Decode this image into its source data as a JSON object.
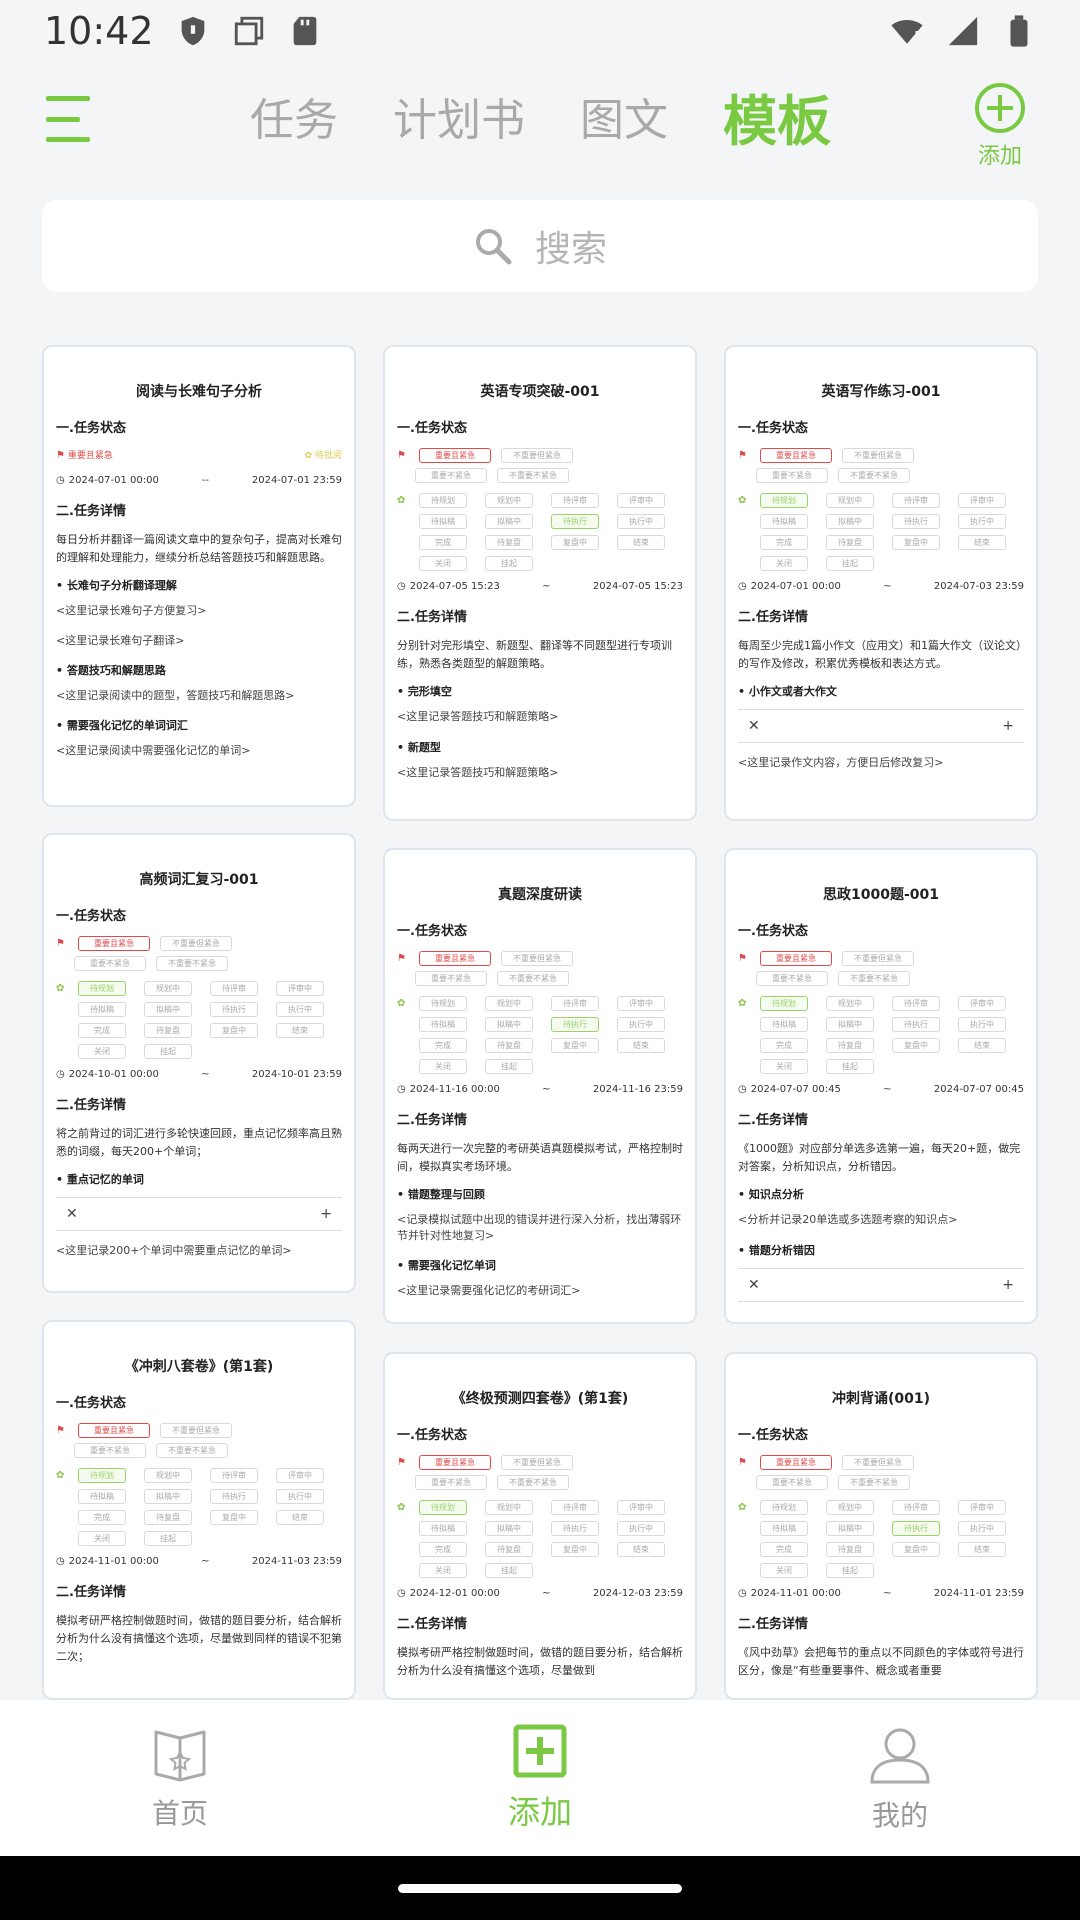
{
  "status_bar": {
    "time": "10:42"
  },
  "header": {
    "tabs": [
      "任务",
      "计划书",
      "图文",
      "模板"
    ],
    "active_tab": "模板",
    "add_label": "添加"
  },
  "search": {
    "placeholder": "搜索"
  },
  "cards": [
    {
      "title": "阅读与长难句子分析",
      "section1": "一.任务状态",
      "status_a": "重要且紧急",
      "status_b": "待批阅",
      "date_start": "2024-07-01 00:00",
      "date_sep": "--",
      "date_end": "2024-07-01 23:59",
      "section2": "二.任务详情",
      "desc": "每日分析并翻译一篇阅读文章中的复杂句子，提高对长难句的理解和处理能力，继续分析总结答题技巧和解题思路。",
      "b1": "长难句子分析翻译理解",
      "n1": "<这里记录长难句子方便复习>",
      "n2": "<这里记录长难句子翻译>",
      "b2": "答题技巧和解题思路",
      "n3": "<这里记录阅读中的题型，答题技巧和解题思路>",
      "b3": "需要强化记忆的单词词汇",
      "n4": "<这里记录阅读中需要强化记忆的单词>"
    },
    {
      "title": "英语专项突破-001",
      "section1": "一.任务状态",
      "date_start": "2024-07-05 15:23",
      "date_sep": "~",
      "date_end": "2024-07-05 15:23",
      "section2": "二.任务详情",
      "desc": "分别针对完形填空、新题型、翻译等不同题型进行专项训练，熟悉各类题型的解题策略。",
      "b1": "完形填空",
      "n1": "<这里记录答题技巧和解题策略>",
      "b2": "新题型",
      "n2": "<这里记录答题技巧和解题策略>"
    },
    {
      "title": "英语写作练习-001",
      "section1": "一.任务状态",
      "date_start": "2024-07-01 00:00",
      "date_sep": "~",
      "date_end": "2024-07-03 23:59",
      "section2": "二.任务详情",
      "desc": "每周至少完成1篇小作文（应用文）和1篇大作文（议论文）的写作及修改，积累优秀模板和表达方式。",
      "b1": "小作文或者大作文",
      "n1": "<这里记录作文内容，方便日后修改复习>"
    },
    {
      "title": "高频词汇复习-001",
      "section1": "一.任务状态",
      "date_start": "2024-10-01 00:00",
      "date_sep": "~",
      "date_end": "2024-10-01 23:59",
      "section2": "二.任务详情",
      "desc": "将之前背过的词汇进行多轮快速回顾，重点记忆频率高且熟悉的词缀，每天200+个单词；",
      "b1": "重点记忆的单词",
      "n1": "<这里记录200+个单词中需要重点记忆的单词>"
    },
    {
      "title": "真题深度研读",
      "section1": "一.任务状态",
      "date_start": "2024-11-16 00:00",
      "date_sep": "~",
      "date_end": "2024-11-16 23:59",
      "section2": "二.任务详情",
      "desc": "每两天进行一次完整的考研英语真题模拟考试，严格控制时间，模拟真实考场环境。",
      "b1": "错题整理与回顾",
      "n1": "<记录模拟试题中出现的错误并进行深入分析，找出薄弱环节并针对性地复习>",
      "b2": "需要强化记忆单词",
      "n2": "<这里记录需要强化记忆的考研词汇>"
    },
    {
      "title": "思政1000题-001",
      "section1": "一.任务状态",
      "date_start": "2024-07-07 00:45",
      "date_sep": "~",
      "date_end": "2024-07-07 00:45",
      "section2": "二.任务详情",
      "desc": "《1000题》对应部分单选多选第一遍，每天20+题，做完对答案，分析知识点，分析错因。",
      "b1": "知识点分析",
      "n1": "<分析并记录20单选或多选题考察的知识点>",
      "b2": "错题分析错因"
    },
    {
      "title": "《冲刺八套卷》(第1套)",
      "section1": "一.任务状态",
      "date_start": "2024-11-01 00:00",
      "date_sep": "~",
      "date_end": "2024-11-03 23:59",
      "section2": "二.任务详情",
      "desc": "模拟考研严格控制做题时间，做错的题目要分析，结合解析分析为什么没有搞懂这个选项，尽量做到同样的错误不犯第二次；"
    },
    {
      "title": "《终极预测四套卷》(第1套)",
      "section1": "一.任务状态",
      "date_start": "2024-12-01 00:00",
      "date_sep": "~",
      "date_end": "2024-12-03 23:59",
      "section2": "二.任务详情",
      "desc": "模拟考研严格控制做题时间，做错的题目要分析，结合解析分析为什么没有搞懂这个选项，尽量做到"
    },
    {
      "title": "冲刺背诵(001)",
      "section1": "一.任务状态",
      "date_start": "2024-11-01 00:00",
      "date_sep": "~",
      "date_end": "2024-11-01 23:59",
      "section2": "二.任务详情",
      "desc": "《风中劲草》会把每节的重点以不同颜色的字体或符号进行区分，像是“有些重要事件、概念或者重要"
    }
  ],
  "priority_chips": [
    "重要且紧急",
    "不重要但紧急",
    "重要不紧急",
    "不重要不紧急"
  ],
  "status_chips": [
    "待规划",
    "规划中",
    "待评审",
    "评审中",
    "待拟稿",
    "拟稿中",
    "待执行",
    "执行中",
    "完成",
    "待复盘",
    "复盘中",
    "结束",
    "关闭",
    "挂起"
  ],
  "bottom_nav": [
    {
      "label": "首页",
      "icon": "book-star-icon"
    },
    {
      "label": "添加",
      "icon": "plus-square-icon"
    },
    {
      "label": "我的",
      "icon": "user-icon"
    }
  ],
  "colors": {
    "accent": "#7ac943",
    "danger": "#e04a4a",
    "muted": "#a9a9a9"
  }
}
